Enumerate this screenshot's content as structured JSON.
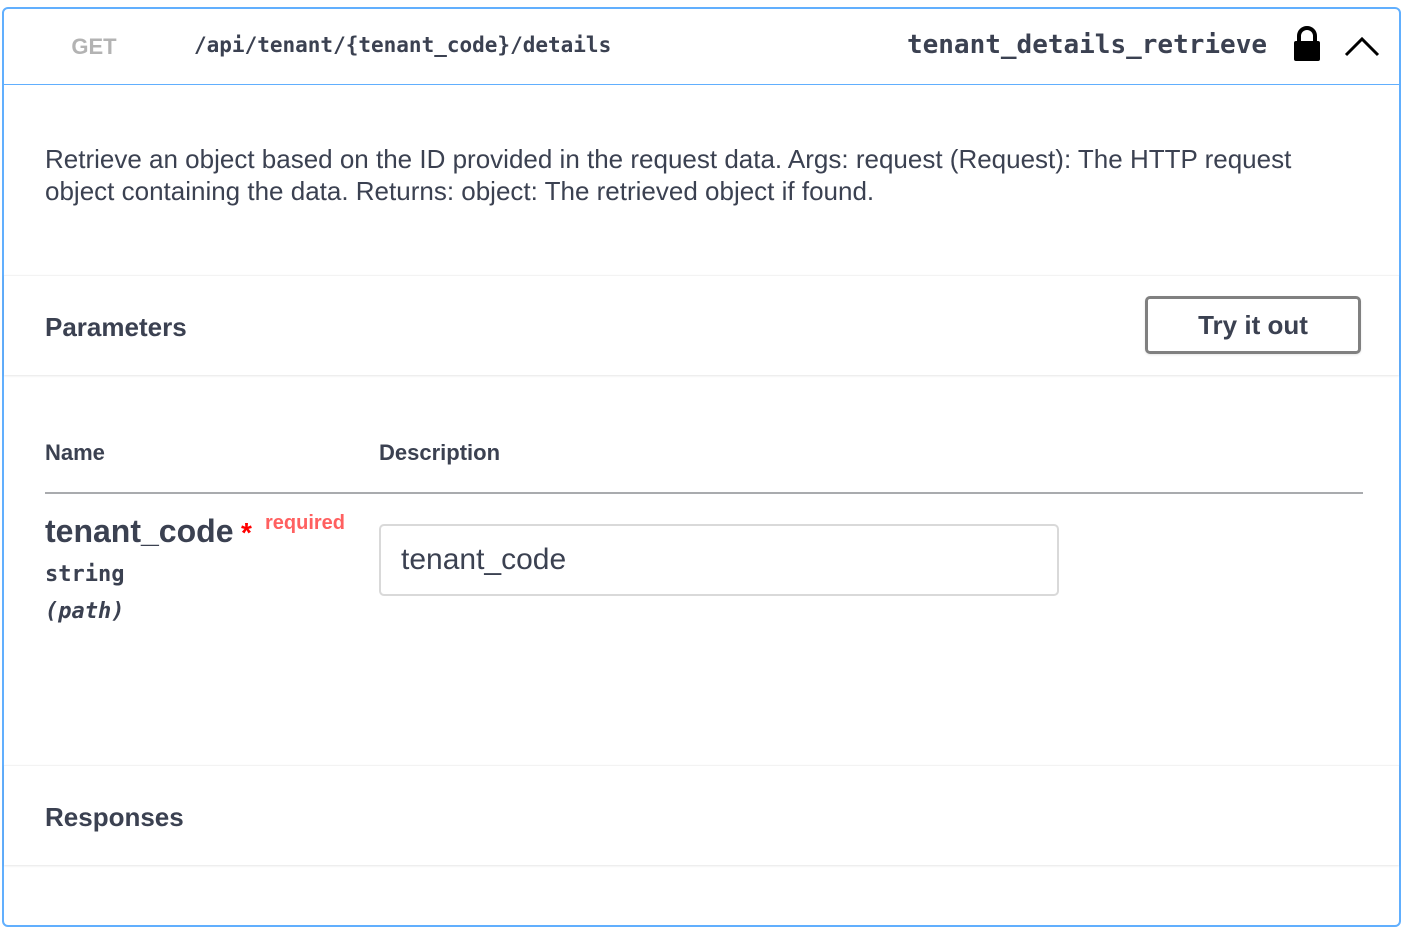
{
  "operation": {
    "method": "GET",
    "path": "/api/tenant/{tenant_code}/details",
    "operation_id": "tenant_details_retrieve",
    "icons": {
      "lock": "lock-icon",
      "collapse": "chevron-up-icon"
    },
    "method_color": "#b3b3b3",
    "border_color": "#61affe"
  },
  "description": "Retrieve an object based on the ID provided in the request data. Args: request (Request): The HTTP request object containing the data. Returns: object: The retrieved object if found.",
  "parameters": {
    "title": "Parameters",
    "try_button_label": "Try it out",
    "columns": {
      "name": "Name",
      "description": "Description"
    },
    "items": [
      {
        "name": "tenant_code",
        "required_star": "*",
        "required_label": "required",
        "type": "string",
        "in": "(path)",
        "placeholder": "tenant_code",
        "value": ""
      }
    ]
  },
  "responses": {
    "title": "Responses"
  }
}
